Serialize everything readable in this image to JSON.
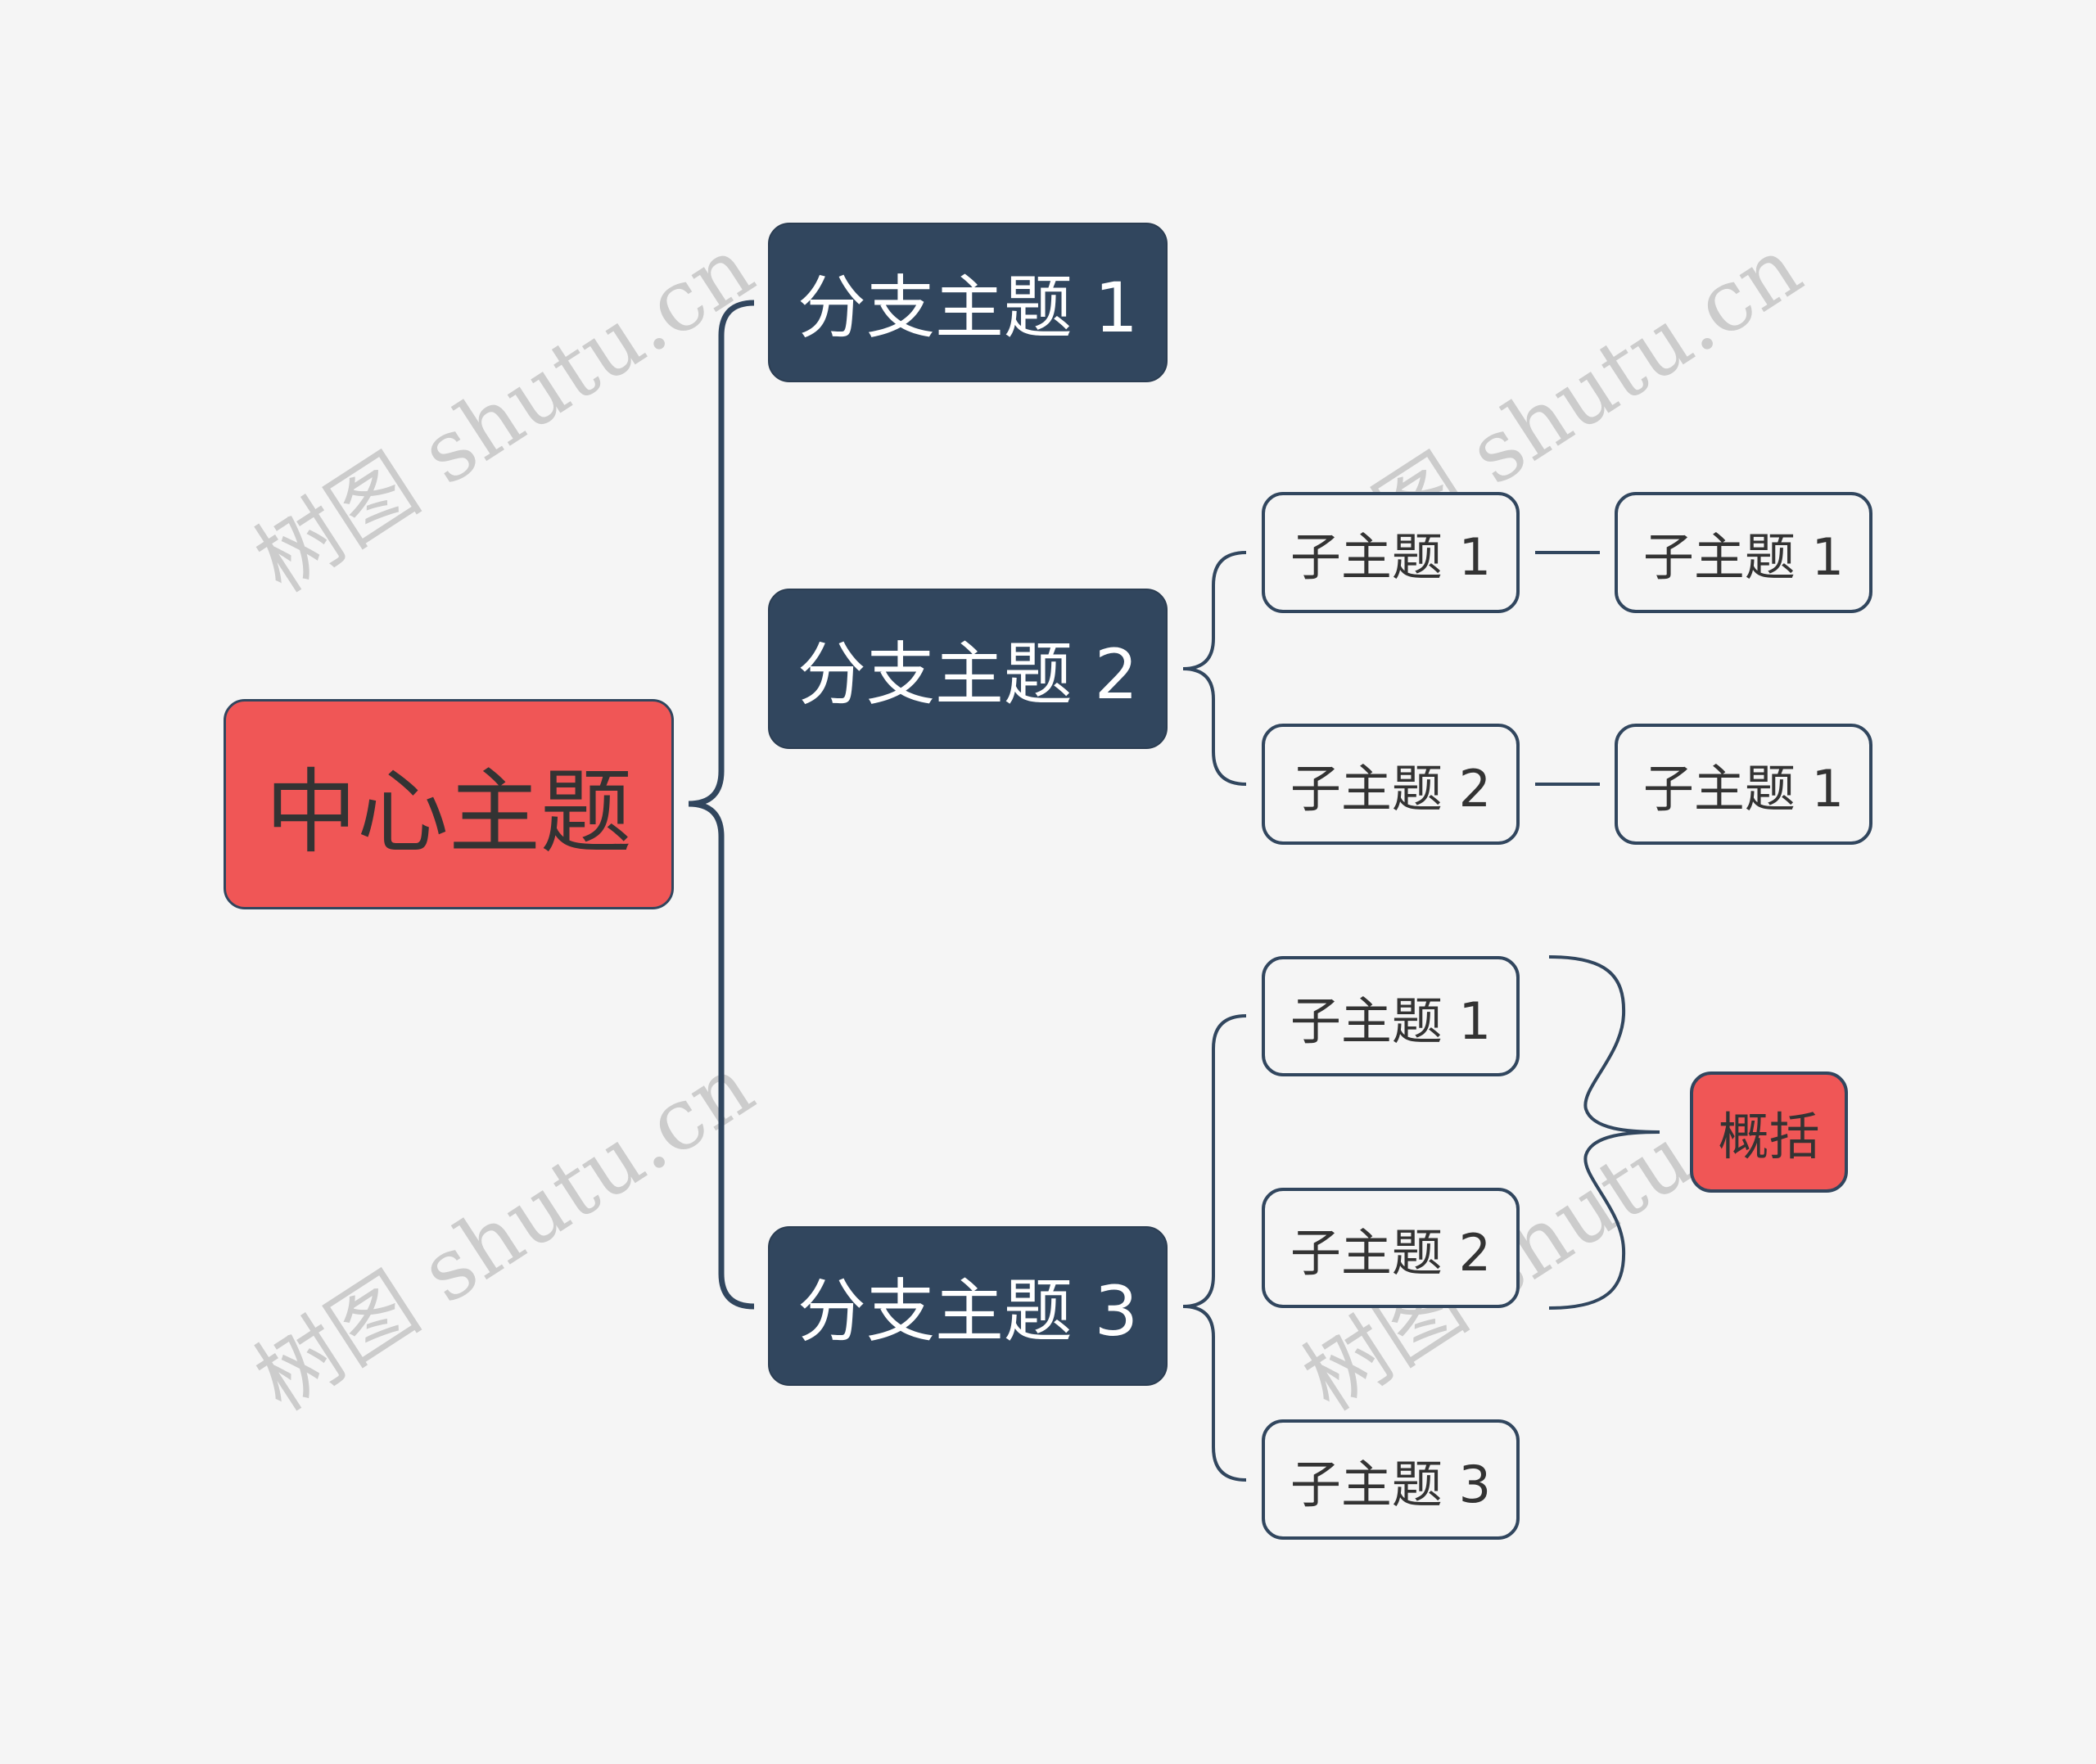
{
  "mindmap": {
    "central": {
      "label": "中心主题",
      "fill": "#f05656"
    },
    "branches": [
      {
        "label": "分支主题 1",
        "children": []
      },
      {
        "label": "分支主题 2",
        "children": [
          {
            "label": "子主题 1",
            "children": [
              {
                "label": "子主题 1"
              }
            ]
          },
          {
            "label": "子主题 2",
            "children": [
              {
                "label": "子主题 1"
              }
            ]
          }
        ]
      },
      {
        "label": "分支主题 3",
        "children": [
          {
            "label": "子主题 1",
            "children": []
          },
          {
            "label": "子主题 2",
            "children": []
          },
          {
            "label": "子主题 3",
            "children": []
          }
        ]
      }
    ],
    "summary": {
      "label": "概括",
      "covers": [
        "分支主题 3 / 子主题 1",
        "分支主题 3 / 子主题 2"
      ]
    }
  },
  "colors": {
    "background": "#f5f5f5",
    "branch_fill": "#31465e",
    "line": "#31465e",
    "accent": "#f05656",
    "watermark": "#cccccc"
  },
  "watermark": {
    "text": "树图 shutu.cn"
  }
}
